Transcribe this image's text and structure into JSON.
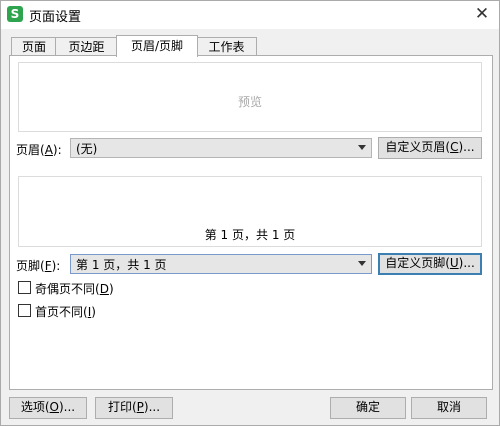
{
  "window": {
    "title": "页面设置",
    "app_icon_letter": "S"
  },
  "tabs": [
    {
      "label": "页面",
      "active": false
    },
    {
      "label": "页边距",
      "active": false
    },
    {
      "label": "页眉/页脚",
      "active": true
    },
    {
      "label": "工作表",
      "active": false
    }
  ],
  "header": {
    "preview_hint": "预览",
    "label": "页眉(A):",
    "value": "(无)",
    "custom_button": "自定义页眉(C)..."
  },
  "footer": {
    "preview_text": "第 1 页，共 1 页",
    "label": "页脚(F):",
    "value": "第 1 页，共 1 页",
    "custom_button": "自定义页脚(U)..."
  },
  "options": {
    "odd_even": {
      "label": "奇偶页不同(D)",
      "checked": false
    },
    "first_page": {
      "label": "首页不同(I)",
      "checked": false
    }
  },
  "bottom": {
    "options_button": "选项(O)...",
    "print_button": "打印(P)...",
    "ok_button": "确定",
    "cancel_button": "取消"
  }
}
